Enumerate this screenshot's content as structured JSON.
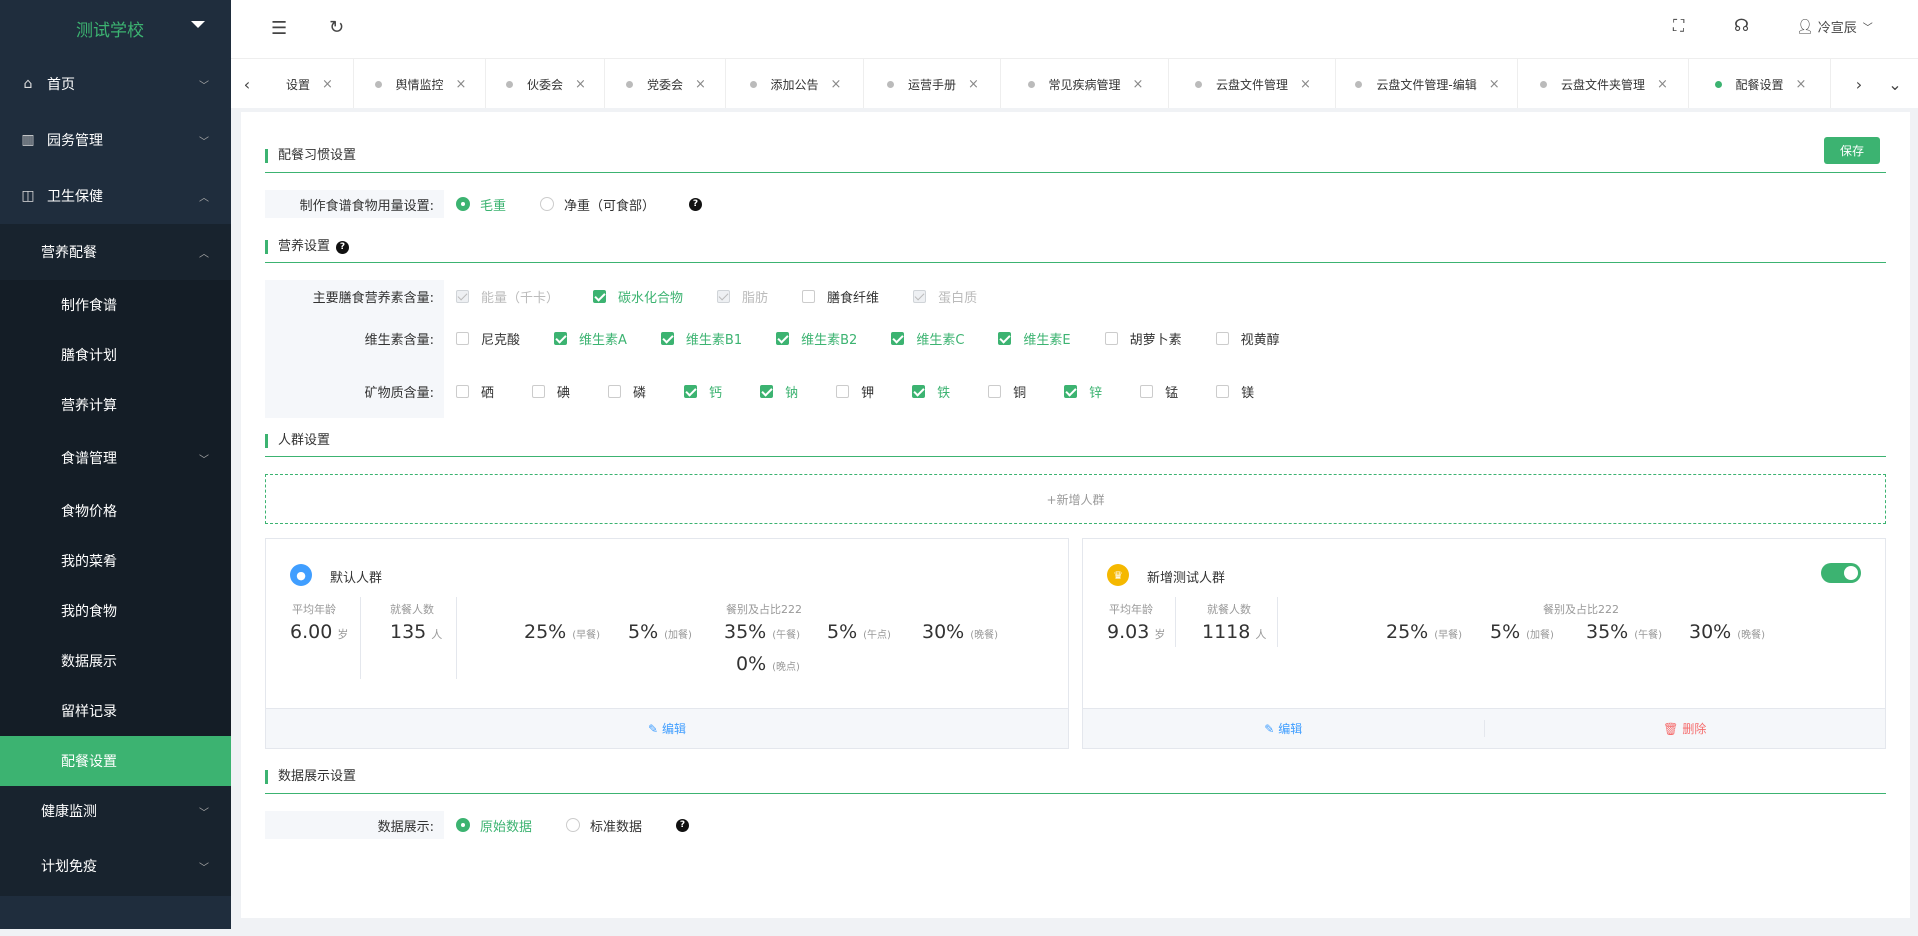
{
  "sidebar": {
    "school": "测试学校",
    "menu": {
      "home": "首页",
      "affairs": "园务管理",
      "health": "卫生保健",
      "nutrition": "营养配餐",
      "make_recipe": "制作食谱",
      "meal_plan": "膳食计划",
      "nutri_calc": "营养计算",
      "recipe_mgmt": "食谱管理",
      "food_price": "食物价格",
      "my_dishes": "我的菜肴",
      "my_food": "我的食物",
      "data_show": "数据展示",
      "sample_record": "留样记录",
      "meal_settings": "配餐设置",
      "health_monitor": "健康监测",
      "immunization": "计划免疫"
    }
  },
  "topbar": {
    "user": "冷宣辰"
  },
  "tabs": [
    {
      "label": "设置",
      "active": false
    },
    {
      "label": "舆情监控",
      "active": false
    },
    {
      "label": "伙委会",
      "active": false
    },
    {
      "label": "党委会",
      "active": false
    },
    {
      "label": "添加公告",
      "active": false
    },
    {
      "label": "运营手册",
      "active": false
    },
    {
      "label": "常见疾病管理",
      "active": false
    },
    {
      "label": "云盘文件管理",
      "active": false
    },
    {
      "label": "云盘文件管理-编辑",
      "active": false
    },
    {
      "label": "云盘文件夹管理",
      "active": false
    },
    {
      "label": "配餐设置",
      "active": true
    }
  ],
  "page": {
    "save": "保存",
    "habit_section": "配餐习惯设置",
    "food_usage_label": "制作食谱食物用量设置:",
    "gross_weight": "毛重",
    "net_weight": "净重（可食部）",
    "nutrition_section": "营养设置",
    "main_nutrients_label": "主要膳食营养素含量:",
    "main_nutrients": [
      {
        "label": "能量（千卡）",
        "state": "disabled"
      },
      {
        "label": "碳水化合物",
        "state": "on"
      },
      {
        "label": "脂肪",
        "state": "disabled"
      },
      {
        "label": "膳食纤维",
        "state": "off"
      },
      {
        "label": "蛋白质",
        "state": "disabled"
      }
    ],
    "vitamins_label": "维生素含量:",
    "vitamins": [
      {
        "label": "尼克酸",
        "state": "off"
      },
      {
        "label": "维生素A",
        "state": "on"
      },
      {
        "label": "维生素B1",
        "state": "on"
      },
      {
        "label": "维生素B2",
        "state": "on"
      },
      {
        "label": "维生素C",
        "state": "on"
      },
      {
        "label": "维生素E",
        "state": "on"
      },
      {
        "label": "胡萝卜素",
        "state": "off"
      },
      {
        "label": "视黄醇",
        "state": "off"
      }
    ],
    "minerals_label": "矿物质含量:",
    "minerals": [
      {
        "label": "硒",
        "state": "off"
      },
      {
        "label": "碘",
        "state": "off"
      },
      {
        "label": "磷",
        "state": "off"
      },
      {
        "label": "钙",
        "state": "on"
      },
      {
        "label": "钠",
        "state": "on"
      },
      {
        "label": "钾",
        "state": "off"
      },
      {
        "label": "铁",
        "state": "on"
      },
      {
        "label": "铜",
        "state": "off"
      },
      {
        "label": "锌",
        "state": "on"
      },
      {
        "label": "锰",
        "state": "off"
      },
      {
        "label": "镁",
        "state": "off"
      }
    ],
    "group_section": "人群设置",
    "add_group": "+新增人群",
    "stat_labels": {
      "avg_age": "平均年龄",
      "diners": "就餐人数",
      "meals": "餐别及占比222"
    },
    "groups": [
      {
        "name": "默认人群",
        "avg_age": "6.00",
        "age_unit": "岁",
        "diners": "135",
        "diner_unit": "人",
        "meals": [
          {
            "pct": "25%",
            "name": "(早餐)"
          },
          {
            "pct": "5%",
            "name": "(加餐)"
          },
          {
            "pct": "35%",
            "name": "(午餐)"
          },
          {
            "pct": "5%",
            "name": "(午点)"
          },
          {
            "pct": "30%",
            "name": "(晚餐)"
          },
          {
            "pct": "0%",
            "name": "(晚点)"
          }
        ],
        "edit": "编辑"
      },
      {
        "name": "新增测试人群",
        "avg_age": "9.03",
        "age_unit": "岁",
        "diners": "1118",
        "diner_unit": "人",
        "enabled": true,
        "meals": [
          {
            "pct": "25%",
            "name": "(早餐)"
          },
          {
            "pct": "5%",
            "name": "(加餐)"
          },
          {
            "pct": "35%",
            "name": "(午餐)"
          },
          {
            "pct": "30%",
            "name": "(晚餐)"
          }
        ],
        "edit": "编辑",
        "delete": "删除"
      }
    ],
    "display_section": "数据展示设置",
    "display_label": "数据展示:",
    "raw_data": "原始数据",
    "std_data": "标准数据"
  },
  "colors": {
    "accent": "#3cb371",
    "sidebar": "#1f2d3d",
    "link": "#409eff",
    "danger": "#f56c6c"
  }
}
